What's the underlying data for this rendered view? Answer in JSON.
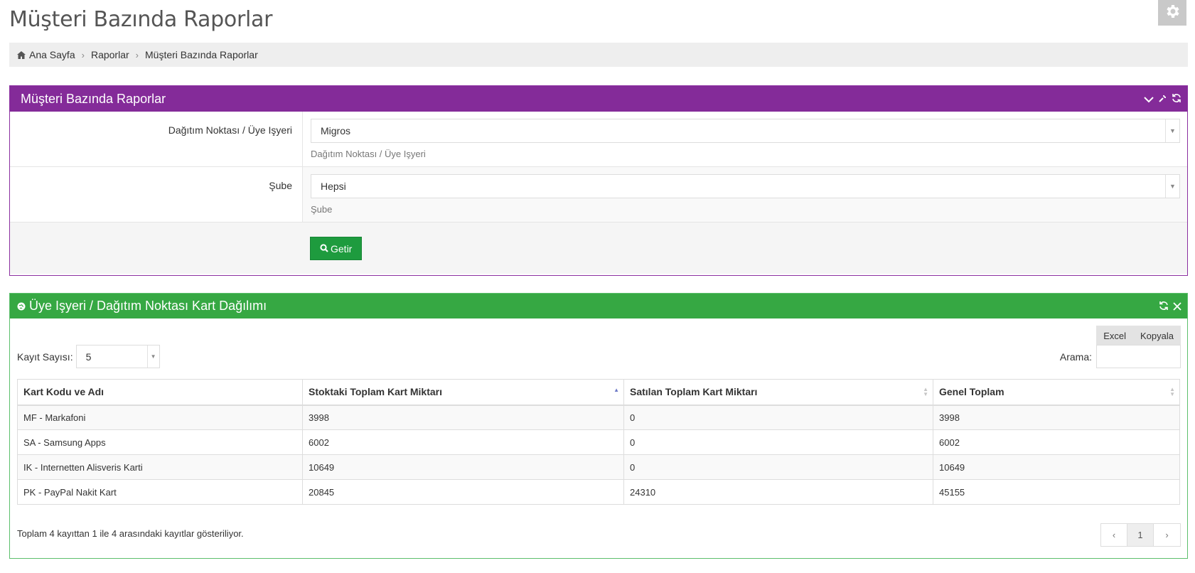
{
  "page": {
    "title": "Müşteri Bazında Raporlar"
  },
  "breadcrumb": {
    "items": [
      "Ana Sayfa",
      "Raporlar",
      "Müşteri Bazında Raporlar"
    ]
  },
  "filter_panel": {
    "title": "Müşteri Bazında Raporlar",
    "color": "#842b99",
    "fields": [
      {
        "label": "Dağıtım Noktası / Üye Işyeri",
        "value": "Migros",
        "help": "Dağıtım Noktası / Üye Işyeri"
      },
      {
        "label": "Şube",
        "value": "Hepsi",
        "help": "Şube"
      }
    ],
    "submit_label": "Getir"
  },
  "results_panel": {
    "title": "Üye Işyeri / Dağıtım Noktası Kart Dağılımı",
    "color": "#36a843",
    "export_buttons": [
      "Excel",
      "Kopyala"
    ],
    "length_label": "Kayıt Sayısı:",
    "length_value": "5",
    "search_label": "Arama:",
    "search_value": "",
    "columns": [
      "Kart Kodu ve Adı",
      "Stoktaki Toplam Kart Miktarı",
      "Satılan Toplam Kart Miktarı",
      "Genel Toplam"
    ],
    "rows": [
      [
        "MF - Markafoni",
        "3998",
        "0",
        "3998"
      ],
      [
        "SA - Samsung Apps",
        "6002",
        "0",
        "6002"
      ],
      [
        "IK - Internetten Alisveris Karti",
        "10649",
        "0",
        "10649"
      ],
      [
        "PK - PayPal Nakit Kart",
        "20845",
        "24310",
        "45155"
      ]
    ],
    "info": "Toplam 4 kayıttan 1 ile 4 arasındaki kayıtlar gösteriliyor.",
    "pager": {
      "prev": "‹",
      "current": "1",
      "next": "›"
    }
  }
}
